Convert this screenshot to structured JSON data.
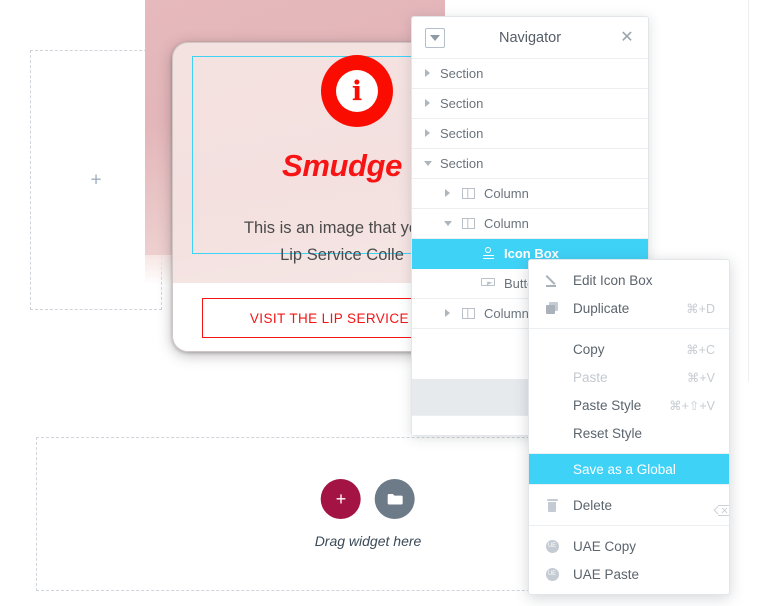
{
  "canvas": {
    "left_column": {
      "add_icon": "plus-icon"
    },
    "card": {
      "info_icon": "info-circle-icon",
      "headline": "Smudge",
      "subtext_line1": "This is an image that you c",
      "subtext_line2": "Lip Service Colle",
      "cta_label": "VISIT THE LIP SERVICE CO"
    },
    "dropzone": {
      "add_icon": "plus-icon",
      "folder_icon": "folder-icon",
      "label": "Drag widget here"
    }
  },
  "navigator": {
    "title": "Navigator",
    "dropdown_icon": "chevron-down-box-icon",
    "close_icon": "close-icon",
    "tree": [
      {
        "label": "Section",
        "indent": 0,
        "caret": "closed",
        "icon": null,
        "selected": false
      },
      {
        "label": "Section",
        "indent": 0,
        "caret": "closed",
        "icon": null,
        "selected": false
      },
      {
        "label": "Section",
        "indent": 0,
        "caret": "closed",
        "icon": null,
        "selected": false
      },
      {
        "label": "Section",
        "indent": 0,
        "caret": "open",
        "icon": null,
        "selected": false
      },
      {
        "label": "Column",
        "indent": 1,
        "caret": "closed",
        "icon": "column",
        "selected": false
      },
      {
        "label": "Column",
        "indent": 1,
        "caret": "open",
        "icon": "column",
        "selected": false
      },
      {
        "label": "Icon Box",
        "indent": 2,
        "caret": "none",
        "icon": "iconbox",
        "selected": true
      },
      {
        "label": "Button",
        "indent": 2,
        "caret": "none",
        "icon": "button",
        "selected": false
      },
      {
        "label": "Column",
        "indent": 1,
        "caret": "closed",
        "icon": "column",
        "selected": false
      }
    ]
  },
  "context_menu": {
    "groups": [
      {
        "items": [
          {
            "label": "Edit Icon Box",
            "shortcut": "",
            "icon": "pencil-icon",
            "state": "normal"
          },
          {
            "label": "Duplicate",
            "shortcut": "⌘+D",
            "icon": "duplicate-icon",
            "state": "normal"
          }
        ]
      },
      {
        "items": [
          {
            "label": "Copy",
            "shortcut": "⌘+C",
            "icon": null,
            "state": "normal"
          },
          {
            "label": "Paste",
            "shortcut": "⌘+V",
            "icon": null,
            "state": "disabled"
          },
          {
            "label": "Paste Style",
            "shortcut": "⌘+⇧+V",
            "icon": null,
            "state": "normal"
          },
          {
            "label": "Reset Style",
            "shortcut": "",
            "icon": null,
            "state": "normal"
          }
        ]
      },
      {
        "items": [
          {
            "label": "Save as a Global",
            "shortcut": "",
            "icon": null,
            "state": "highlight"
          }
        ]
      },
      {
        "items": [
          {
            "label": "Delete",
            "shortcut": "",
            "icon": "trash-icon",
            "state": "normal",
            "trailing_icon": "backspace-icon"
          }
        ]
      },
      {
        "items": [
          {
            "label": "UAE Copy",
            "shortcut": "",
            "icon": "uae-icon",
            "state": "normal"
          },
          {
            "label": "UAE Paste",
            "shortcut": "",
            "icon": "uae-icon",
            "state": "normal"
          }
        ]
      }
    ]
  },
  "colors": {
    "accent_cyan": "#3fd2f7",
    "brand_red": "#f41414",
    "info_red": "#fa0d00",
    "dropzone_add": "#a31444",
    "dropzone_folder": "#6d7a87"
  }
}
